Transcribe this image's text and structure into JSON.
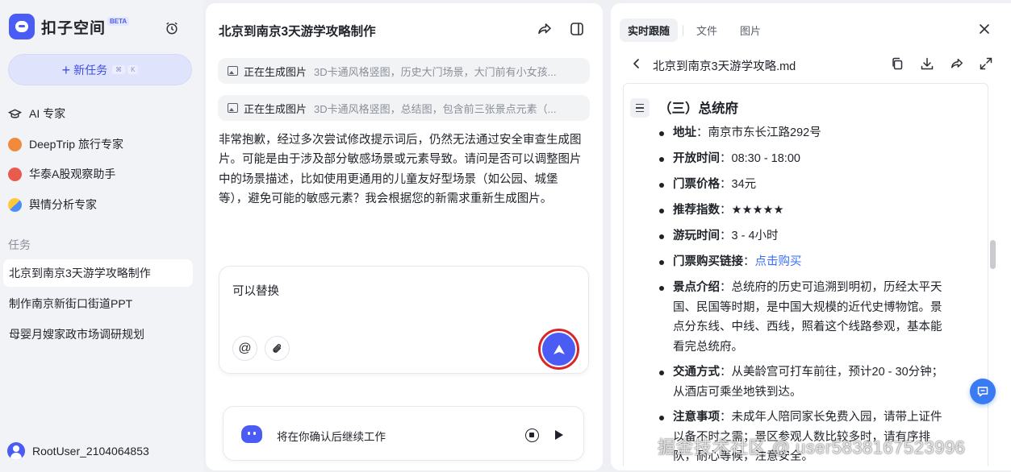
{
  "app": {
    "name": "扣子空间",
    "badge": "BETA"
  },
  "sidebar": {
    "new_task_label": "新任务",
    "new_task_shortcut": [
      "⌘",
      "K"
    ],
    "agents": [
      {
        "label": "AI 专家",
        "icon": "graduation-cap-icon"
      },
      {
        "label": "DeepTrip 旅行专家",
        "icon": "deeptrip-icon"
      },
      {
        "label": "华泰A股观察助手",
        "icon": "stock-icon"
      },
      {
        "label": "舆情分析专家",
        "icon": "opinion-icon"
      }
    ],
    "tasks_title": "任务",
    "tasks": [
      {
        "label": "北京到南京3天游学攻略制作",
        "active": true
      },
      {
        "label": "制作南京新街口街道PPT",
        "active": false
      },
      {
        "label": "母婴月嫂家政市场调研规划",
        "active": false
      }
    ],
    "user": "RootUser_2104064853"
  },
  "chat": {
    "title": "北京到南京3天游学攻略制作",
    "generations": [
      {
        "status": "正在生成图片",
        "desc": "3D卡通风格竖图，历史大门场景，大门前有小女孩..."
      },
      {
        "status": "正在生成图片",
        "desc": "3D卡通风格竖图，总结图，包含前三张景点元素（..."
      }
    ],
    "reply": "非常抱歉，经过多次尝试修改提示词后，仍然无法通过安全审查生成图片。可能是由于涉及部分敏感场景或元素导致。请问是否可以调整图片中的场景描述，比如使用更通用的儿童友好型场景（如公园、城堡等），避免可能的敏感元素？我会根据您的新需求重新生成图片。",
    "input_value": "可以替换",
    "status_text": "将在你确认后继续工作"
  },
  "doc": {
    "tabs": [
      "实时跟随",
      "文件",
      "图片"
    ],
    "active_tab": 0,
    "file_name": "北京到南京3天游学攻略.md",
    "section_title": "（三）总统府",
    "items": [
      {
        "key": "地址",
        "sep": "：",
        "value": "南京市东长江路292号"
      },
      {
        "key": "开放时间",
        "sep": "：",
        "value": "08:30 - 18:00"
      },
      {
        "key": "门票价格",
        "sep": "：",
        "value": "34元"
      },
      {
        "key": "推荐指数",
        "sep": "：",
        "value": "★★★★★"
      },
      {
        "key": "游玩时间",
        "sep": "：",
        "value": "3 - 4小时"
      },
      {
        "key": "门票购买链接",
        "sep": "：",
        "value": "点击购买",
        "is_link": true
      },
      {
        "key": "景点介绍",
        "sep": "：",
        "value": "总统府的历史可追溯到明初，历经太平天国、民国等时期，是中国大规模的近代史博物馆。景点分东线、中线、西线，照着这个线路参观，基本能看完总统府。"
      },
      {
        "key": "交通方式",
        "sep": "：",
        "value": "从美龄宫可打车前往，预计20 - 30分钟；从酒店可乘坐地铁到达。"
      },
      {
        "key": "注意事项",
        "sep": "：",
        "value": "未成年人陪同家长免费入园，请带上证件以备不时之需；景区参观人数比较多时，请有序排队，耐心等候，注意安全。"
      }
    ]
  },
  "watermark": "掘金技术社区 @ user5838167523996",
  "colors": {
    "brand": "#4b5cf4",
    "highlight_ring": "#d9262b",
    "link": "#3a6ff2"
  }
}
